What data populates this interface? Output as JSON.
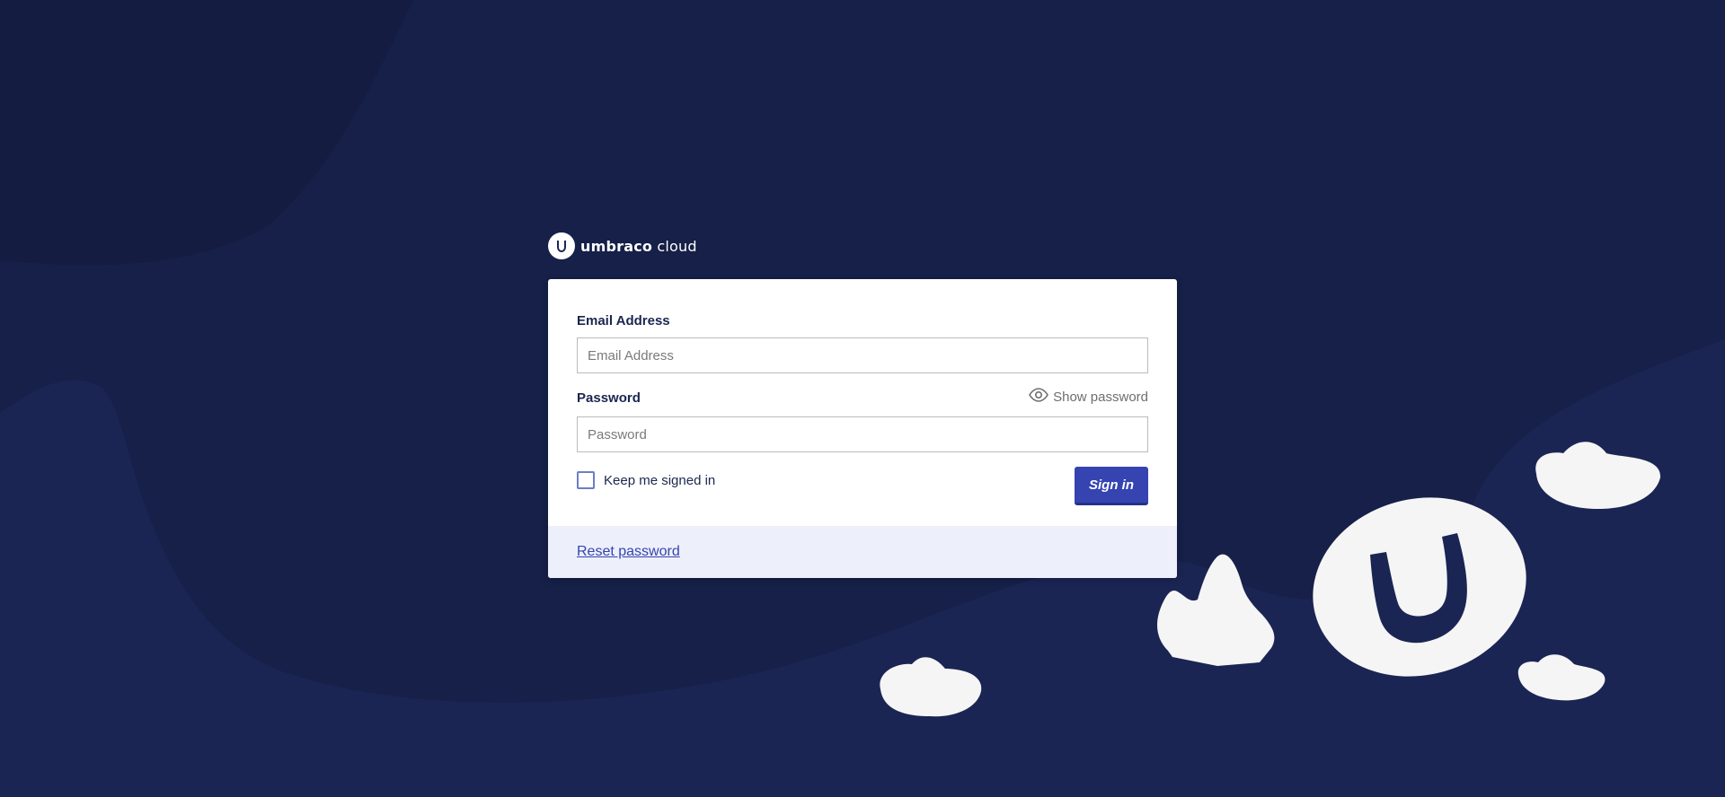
{
  "brand": {
    "name_part1": "umbraco",
    "name_part2": "cloud"
  },
  "form": {
    "email_label": "Email Address",
    "email_placeholder": "Email Address",
    "email_value": "",
    "password_label": "Password",
    "password_placeholder": "Password",
    "password_value": "",
    "show_password_label": "Show password",
    "keep_signed_in_label": "Keep me signed in",
    "keep_signed_in_checked": false,
    "sign_in_label": "Sign in",
    "reset_password_label": "Reset password"
  },
  "colors": {
    "background": "#1b2553",
    "background_dark": "#162048",
    "primary": "#3544b1",
    "footer": "#edf0fa",
    "cloud": "#f5f5f5"
  }
}
